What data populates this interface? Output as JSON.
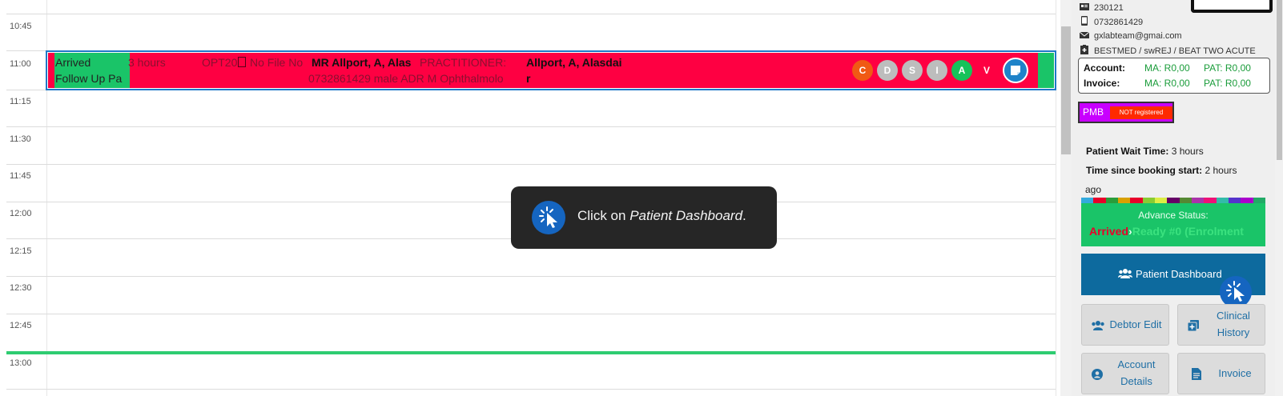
{
  "calendar": {
    "times": [
      "10:45",
      "11:00",
      "11:15",
      "11:30",
      "11:45",
      "12:00",
      "12:15",
      "12:30",
      "12:45",
      "13:00"
    ]
  },
  "appointment": {
    "status": "Arrived",
    "visit_type": "Follow Up Pa",
    "wait": "3 hours",
    "code": "OPT20",
    "file": "No File No",
    "patient_name": "MR Allport, A, Alas",
    "details": "0732861429 male ADR M Ophthalmolo",
    "practitioner_label": "PRACTITIONER:",
    "practitioner_name": "Allport, A, Alasdai",
    "practitioner_name_wrap": "r",
    "pills": [
      "C",
      "D",
      "S",
      "I",
      "A",
      "V"
    ]
  },
  "tooltip": {
    "prefix": "Click on",
    "target": "Patient Dashboard",
    "suffix": "."
  },
  "panel": {
    "id_number": "230121",
    "phone": "0732861429",
    "email": "gxlabteam@gmai.com",
    "medical_aid": "BESTMED / swREJ / BEAT TWO ACUTE",
    "account": {
      "account_label": "Account:",
      "invoice_label": "Invoice:",
      "account_ma": "MA: R0,00",
      "account_pat": "PAT: R0,00",
      "invoice_ma": "MA: R0,00",
      "invoice_pat": "PAT: R0,00"
    },
    "pmb_label": "PMB",
    "pmb_status": "NOT registered",
    "wait_label": "Patient Wait Time:",
    "wait_value": "3 hours",
    "booking_label": "Time since booking start:",
    "booking_value": "2 hours",
    "booking_suffix": "ago",
    "advance_title": "Advance Status:",
    "advance_current": "Arrived",
    "advance_next": "Ready #0 (Enrolment",
    "dashboard_button": "Patient Dashboard",
    "debtor_edit": "Debtor Edit",
    "clinical_history_1": "Clinical",
    "clinical_history_2": "History",
    "account_details_1": "Account",
    "account_details_2": "Details",
    "invoice_button": "Invoice"
  },
  "colors": {
    "appointment_bg": "#fe0042",
    "status_green": "#1ac468",
    "dashboard_blue": "#0d6a9e",
    "pmb_purple": "#c800ff",
    "stripe": [
      "#33aadd",
      "#e8002a",
      "#2a9d3a",
      "#d9a000",
      "#e8002a",
      "#88cc33",
      "#ddee44",
      "#660066",
      "#558833",
      "#aa33aa",
      "#ee1177",
      "#33bbaa",
      "#5533cc",
      "#aa00cc",
      "#22aa66"
    ]
  }
}
